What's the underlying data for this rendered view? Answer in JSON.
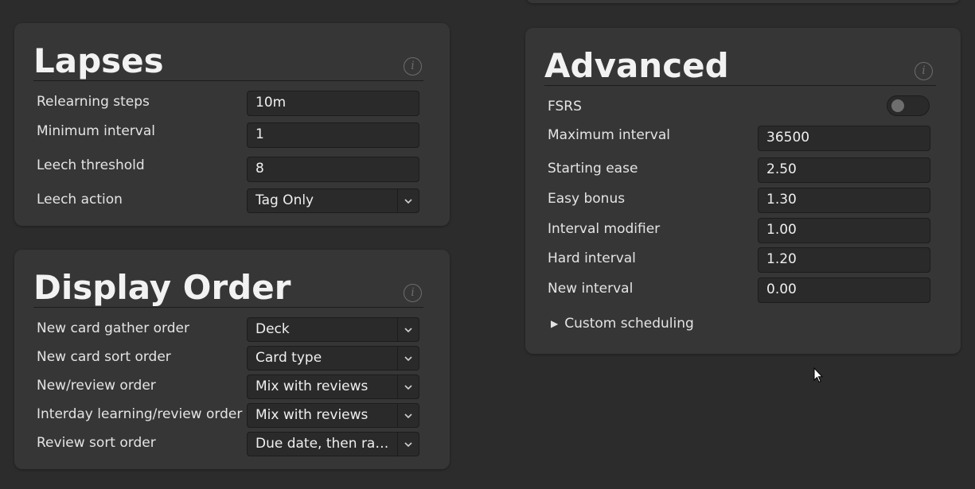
{
  "lapses": {
    "title": "Lapses",
    "info_icon": "info-icon",
    "rows": [
      {
        "label": "Relearning steps",
        "value": "10m"
      },
      {
        "label": "Minimum interval",
        "value": "1"
      },
      {
        "label": "Leech threshold",
        "value": "8"
      },
      {
        "label": "Leech action",
        "value": "Tag Only"
      }
    ]
  },
  "display_order": {
    "title": "Display Order",
    "info_icon": "info-icon",
    "rows": [
      {
        "label": "New card gather order",
        "value": "Deck"
      },
      {
        "label": "New card sort order",
        "value": "Card type"
      },
      {
        "label": "New/review order",
        "value": "Mix with reviews"
      },
      {
        "label": "Interday learning/review order",
        "value": "Mix with reviews"
      },
      {
        "label": "Review sort order",
        "value": "Due date, then ran..."
      }
    ]
  },
  "advanced": {
    "title": "Advanced",
    "info_icon": "info-icon",
    "fsrs": {
      "label": "FSRS",
      "enabled": false
    },
    "rows": [
      {
        "label": "Maximum interval",
        "value": "36500"
      },
      {
        "label": "Starting ease",
        "value": "2.50"
      },
      {
        "label": "Easy bonus",
        "value": "1.30"
      },
      {
        "label": "Interval modifier",
        "value": "1.00"
      },
      {
        "label": "Hard interval",
        "value": "1.20"
      },
      {
        "label": "New interval",
        "value": "0.00"
      }
    ],
    "custom_scheduling": "Custom scheduling"
  },
  "colors": {
    "background": "#2c2c2c",
    "card": "#363636",
    "field": "#2a2a2a"
  }
}
